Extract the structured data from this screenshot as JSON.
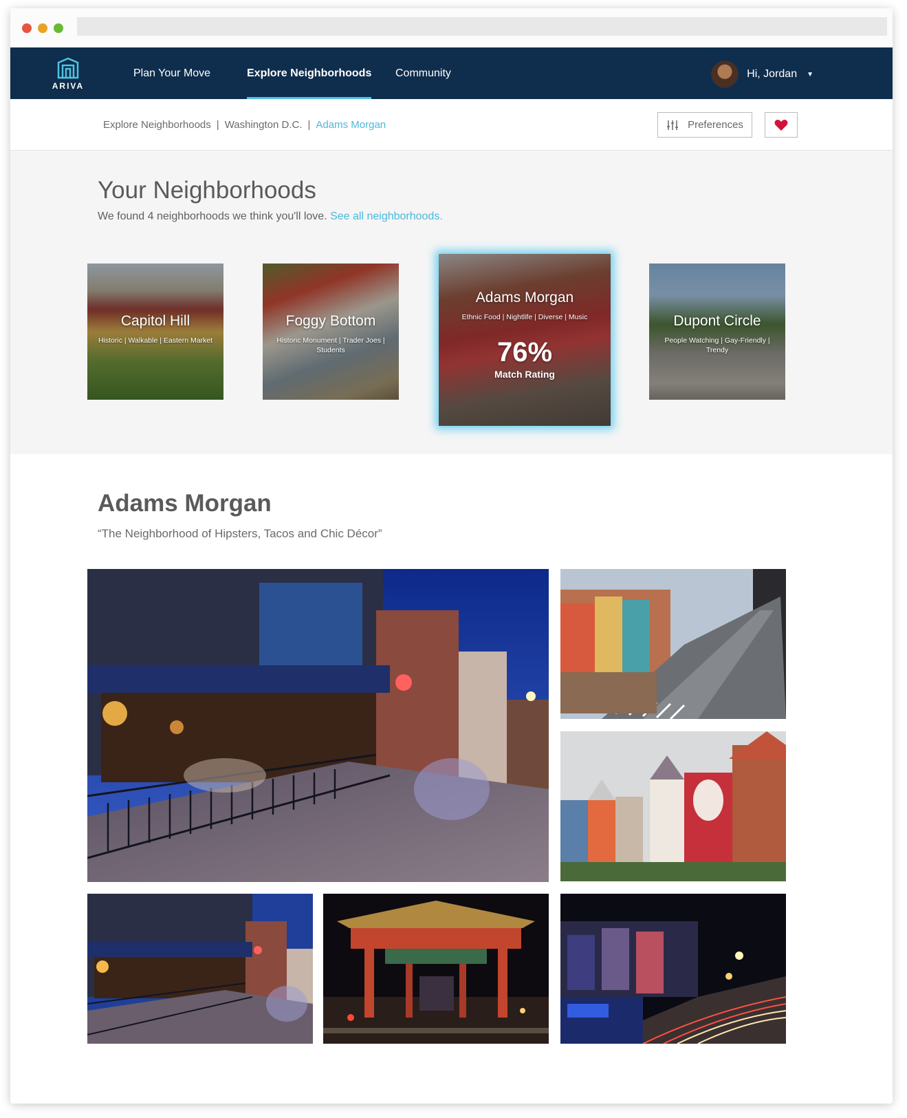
{
  "app": {
    "logo_text": "ARIVA"
  },
  "nav": {
    "links": [
      {
        "label": "Plan Your Move",
        "active": false
      },
      {
        "label": "Explore Neighborhoods",
        "active": true
      },
      {
        "label": "Community",
        "active": false
      }
    ],
    "user_greeting": "Hi, Jordan"
  },
  "breadcrumb": {
    "items": [
      "Explore Neighborhoods",
      "Washington D.C.",
      "Adams Morgan"
    ],
    "separator": "|"
  },
  "toolbar": {
    "preferences_label": "Preferences",
    "favorite_icon": "heart-icon"
  },
  "neighborhoods": {
    "title": "Your Neighborhoods",
    "intro_text": "We found 4 neighborhoods we think you'll love.",
    "see_all_link": "See all neighborhoods.",
    "cards": [
      {
        "name": "Capitol Hill",
        "tags": "Historic | Walkable | Eastern Market"
      },
      {
        "name": "Foggy Bottom",
        "tags": "Historic Monument | Trader Joes | Students"
      },
      {
        "name": "Adams Morgan",
        "tags": "Ethnic Food | Nightlife | Diverse | Music",
        "match_value": "76%",
        "match_label": "Match Rating",
        "featured": true
      },
      {
        "name": "Dupont Circle",
        "tags": "People Watching | Gay-Friendly | Trendy"
      }
    ]
  },
  "detail": {
    "title": "Adams Morgan",
    "tagline": "“The Neighborhood of Hipsters, Tacos and Chic Décor”",
    "photos": [
      "night-restaurant-patio",
      "street-aerial-day",
      "mural-buildings",
      "restaurant-patio-small",
      "chinatown-arch-night",
      "street-night-lights"
    ]
  },
  "colors": {
    "nav_bg": "#0f2d4c",
    "accent": "#4ab8dc",
    "heart": "#d3123a"
  }
}
